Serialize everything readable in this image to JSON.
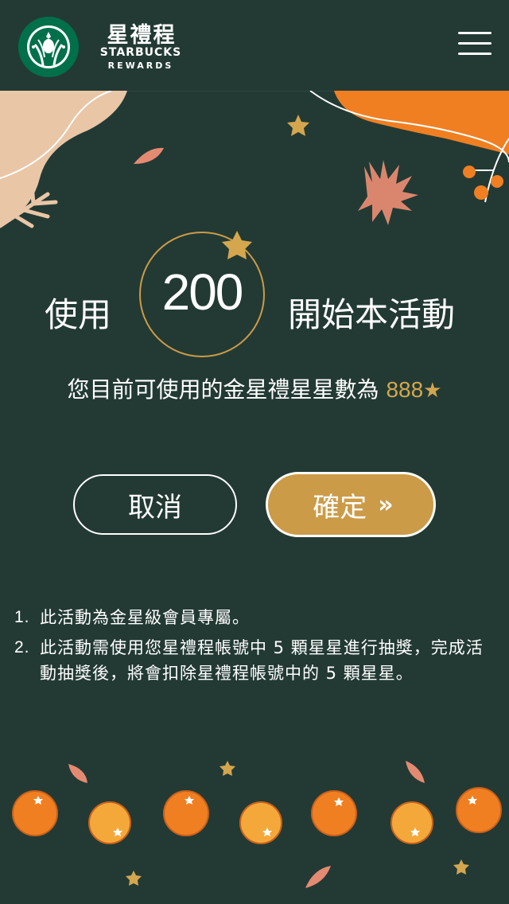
{
  "header": {
    "brand_zh": "星禮程",
    "brand_en": "STARBUCKS",
    "brand_sub": "REWARDS",
    "logo_icon": "starbucks-siren-logo",
    "menu_icon": "hamburger-menu-icon"
  },
  "hero": {
    "prefix": "使用",
    "stars_required": "200",
    "suffix": "開始本活動"
  },
  "balance": {
    "label": "您目前可使用的金星禮星星數為",
    "value": "888",
    "star": "★"
  },
  "actions": {
    "cancel_label": "取消",
    "confirm_label": "確定",
    "confirm_arrow": "»"
  },
  "notes": [
    {
      "index": "1.",
      "text": "此活動為金星級會員專屬。"
    },
    {
      "index": "2.",
      "text": "此活動需使用您星禮程帳號中 5 顆星星進行抽獎，完成活動抽獎後，將會扣除星禮程帳號中的 5 顆星星。"
    }
  ],
  "colors": {
    "background": "#233a34",
    "gold": "#cc9b48",
    "gold_text": "#d4a64e",
    "orange": "#f07f22",
    "beige": "#e9c6a6"
  }
}
